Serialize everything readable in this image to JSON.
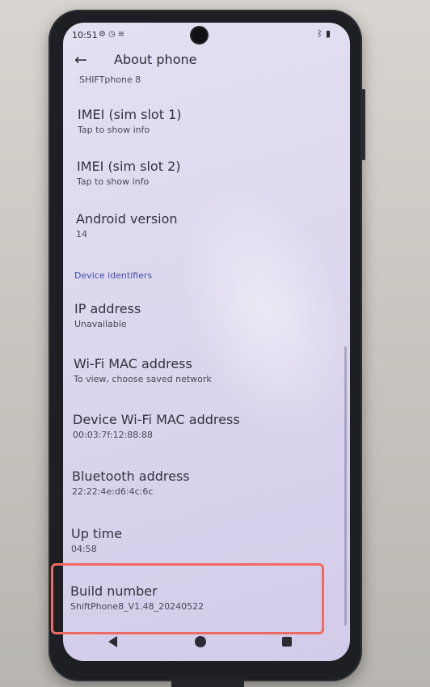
{
  "status_bar": {
    "time": "10:51",
    "left_icons": [
      "gear-icon",
      "alarm-icon",
      "wifi-icon"
    ],
    "right_icons": [
      "bluetooth-icon",
      "battery-icon"
    ]
  },
  "app_bar": {
    "back_icon": "←",
    "title": "About phone"
  },
  "top_cut_text": "SHIFTphone 8",
  "items": [
    {
      "title": "IMEI (sim slot 1)",
      "summary": "Tap to show info"
    },
    {
      "title": "IMEI (sim slot 2)",
      "summary": "Tap to show info"
    },
    {
      "title": "Android version",
      "summary": "14"
    },
    {
      "title": "IP address",
      "summary": "Unavailable"
    },
    {
      "title": "Wi-Fi MAC address",
      "summary": "To view, choose saved network"
    },
    {
      "title": "Device Wi-Fi MAC address",
      "summary": "00:03:7f:12:88:88"
    },
    {
      "title": "Bluetooth address",
      "summary": "22:22:4e:d6:4c:6c"
    },
    {
      "title": "Up time",
      "summary": "04:58"
    },
    {
      "title": "Build number",
      "summary": "ShiftPhone8_V1.48_20240522"
    }
  ],
  "section_header": "Device identifiers",
  "colors": {
    "accent": "#3f4fa6",
    "highlight_box": "#f06a63"
  },
  "nav_icons": [
    "back-triangle-icon",
    "home-circle-icon",
    "recents-square-icon"
  ]
}
